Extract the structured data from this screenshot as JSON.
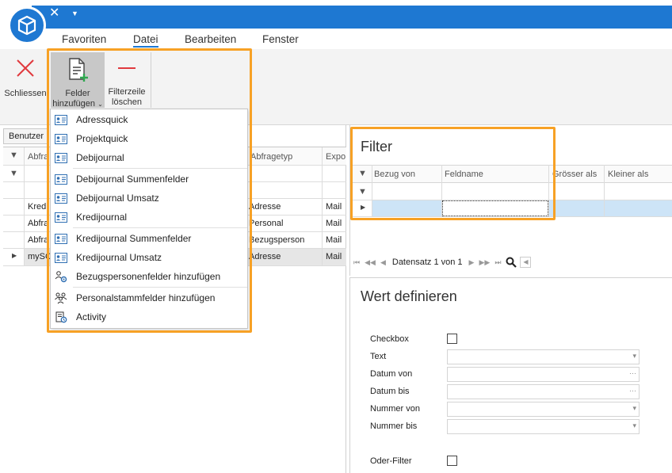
{
  "menu": {
    "items": [
      "Favoriten",
      "Datei",
      "Bearbeiten",
      "Fenster"
    ],
    "active": "Datei"
  },
  "ribbon": {
    "close_label": "Schliessen",
    "add_fields_line1": "Felder",
    "add_fields_line2": "hinzufügen",
    "clear_filter_line1": "Filterzeile",
    "clear_filter_line2": "löschen"
  },
  "left_grid": {
    "tab_label": "Benutzer",
    "col_abfrage": "Abfra",
    "col_abfragetyp": "Abfragetyp",
    "col_export": "Expo",
    "rows": [
      {
        "name": "Kredi",
        "typ": "Adresse",
        "export": "Mail"
      },
      {
        "name": "Abfra",
        "typ": "Personal",
        "export": "Mail"
      },
      {
        "name": "Abfra",
        "typ": "Bezugsperson",
        "export": "Mail"
      },
      {
        "name": "mySC",
        "typ": "Adresse",
        "export": "Mail"
      }
    ]
  },
  "dropdown": {
    "items": [
      {
        "label": "Adressquick",
        "icon": "address-card-icon"
      },
      {
        "label": "Projektquick",
        "icon": "address-card-icon"
      },
      {
        "label": "Debijournal",
        "icon": "address-card-icon"
      },
      {
        "label": "Debijournal Summenfelder",
        "icon": "address-card-icon"
      },
      {
        "label": "Debijournal Umsatz",
        "icon": "address-card-icon"
      },
      {
        "label": "Kredijournal",
        "icon": "address-card-icon"
      },
      {
        "label": "Kredijournal Summenfelder",
        "icon": "address-card-icon"
      },
      {
        "label": "Kredijournal Umsatz",
        "icon": "address-card-icon"
      },
      {
        "label": "Bezugspersonenfelder hinzufügen",
        "icon": "people-gear-icon"
      },
      {
        "label": "Personalstammfelder hinzufügen",
        "icon": "people-group-icon"
      },
      {
        "label": "Activity",
        "icon": "activity-clipboard-icon"
      }
    ]
  },
  "filter": {
    "title": "Filter",
    "columns": [
      "Bezug von",
      "Feldname",
      "Grösser als",
      "Kleiner als"
    ],
    "nav_text": "Datensatz 1 von 1"
  },
  "wert": {
    "title": "Wert definieren",
    "checkbox_label": "Checkbox",
    "text_label": "Text",
    "datum_von_label": "Datum von",
    "datum_bis_label": "Datum bis",
    "nummer_von_label": "Nummer von",
    "nummer_bis_label": "Nummer bis",
    "oder_filter_label": "Oder-Filter"
  },
  "colors": {
    "accent": "#1e78d2",
    "highlight": "#f7a125",
    "close_red": "#e0393e",
    "selected_row": "#cde4f7"
  }
}
